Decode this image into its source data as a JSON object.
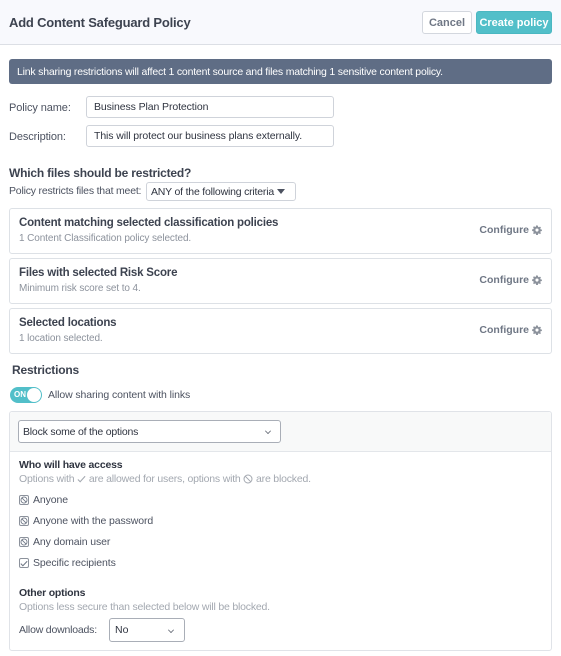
{
  "header": {
    "title": "Add Content Safeguard Policy",
    "cancel_label": "Cancel",
    "create_label": "Create policy"
  },
  "banner": {
    "text": "Link sharing restrictions will affect 1 content source and files matching 1 sensitive content policy."
  },
  "form": {
    "policy_name_label": "Policy name:",
    "policy_name_value": "Business Plan Protection",
    "description_label": "Description:",
    "description_value": "This will protect our business plans externally."
  },
  "files": {
    "title": "Which files should be restricted?",
    "criteria_label": "Policy restricts files that meet:",
    "criteria_value": "ANY of the following criteria",
    "cards": [
      {
        "title": "Content matching selected classification policies",
        "subtitle": "1 Content Classification policy selected.",
        "action": "Configure"
      },
      {
        "title": "Files with selected Risk Score",
        "subtitle": "Minimum risk score set to 4.",
        "action": "Configure"
      },
      {
        "title": "Selected locations",
        "subtitle": "1 location selected.",
        "action": "Configure"
      }
    ]
  },
  "restrictions": {
    "title": "Restrictions",
    "toggle_state": "ON",
    "toggle_label": "Allow sharing content with links",
    "mode_value": "Block some of the options",
    "access_title": "Who will have access",
    "access_hint": "Options with ✓ are allowed for users, options with ⃠ are blocked.",
    "access_hint_parts": [
      "Options with",
      "are allowed for users, options with",
      "are blocked."
    ],
    "options": [
      {
        "label": "Anyone",
        "state": "blocked"
      },
      {
        "label": "Anyone with the password",
        "state": "blocked"
      },
      {
        "label": "Any domain user",
        "state": "blocked"
      },
      {
        "label": "Specific recipients",
        "state": "allowed"
      }
    ],
    "other_title": "Other options",
    "other_hint": "Options less secure than selected below will be blocked.",
    "downloads_label": "Allow downloads:",
    "downloads_value": "No"
  },
  "colors": {
    "accent": "#52bfc9",
    "banner": "#5f6d85",
    "header_bg": "#f8f9fd"
  }
}
